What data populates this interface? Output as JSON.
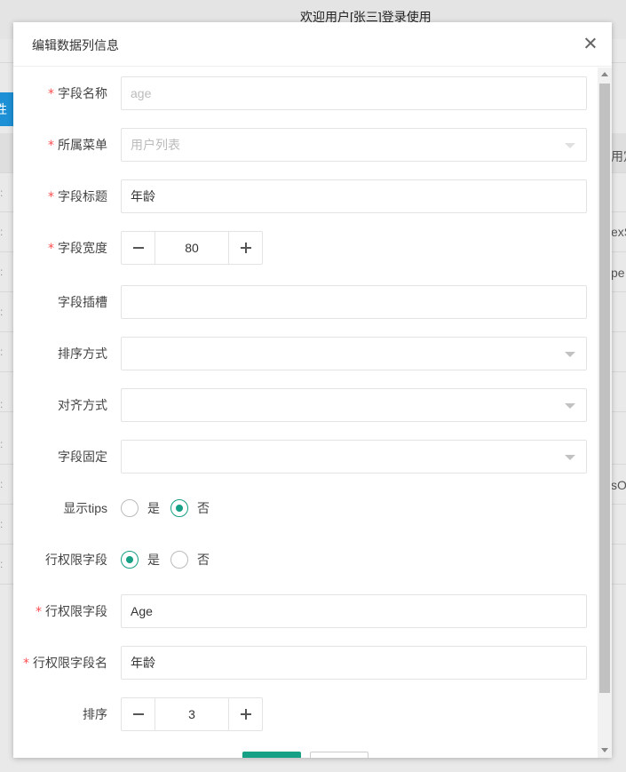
{
  "background": {
    "welcome_text": "欢迎用户[张三]登录使用",
    "blue_button_label": "性",
    "right_edge_texts": [
      "用定",
      "exS",
      "pe",
      "sOp"
    ],
    "left_edge_mark": ":"
  },
  "dialog": {
    "title": "编辑数据列信息",
    "fields": {
      "field_name": {
        "label": "字段名称",
        "required": true,
        "value": "age"
      },
      "menu": {
        "label": "所属菜单",
        "required": true,
        "value": "用户列表"
      },
      "field_title": {
        "label": "字段标题",
        "required": true,
        "value": "年龄"
      },
      "field_width": {
        "label": "字段宽度",
        "required": true,
        "value": "80"
      },
      "field_slot": {
        "label": "字段插槽",
        "required": false,
        "value": ""
      },
      "sort_mode": {
        "label": "排序方式",
        "required": false,
        "value": ""
      },
      "align_mode": {
        "label": "对齐方式",
        "required": false,
        "value": ""
      },
      "field_fixed": {
        "label": "字段固定",
        "required": false,
        "value": ""
      },
      "show_tips": {
        "label": "显示tips",
        "required": false,
        "yes": "是",
        "no": "否",
        "selected": "no"
      },
      "row_perm_field": {
        "label": "行权限字段",
        "required": false,
        "yes": "是",
        "no": "否",
        "selected": "yes"
      },
      "row_perm_field_key": {
        "label": "行权限字段",
        "required": true,
        "value": "Age"
      },
      "row_perm_field_name": {
        "label": "行权限字段名",
        "required": true,
        "value": "年龄"
      },
      "order": {
        "label": "排序",
        "required": false,
        "value": "3"
      }
    },
    "required_mark": "*"
  },
  "colors": {
    "accent": "#16a085",
    "required": "#ff4d4f",
    "bg_blue": "#1e90d6"
  }
}
